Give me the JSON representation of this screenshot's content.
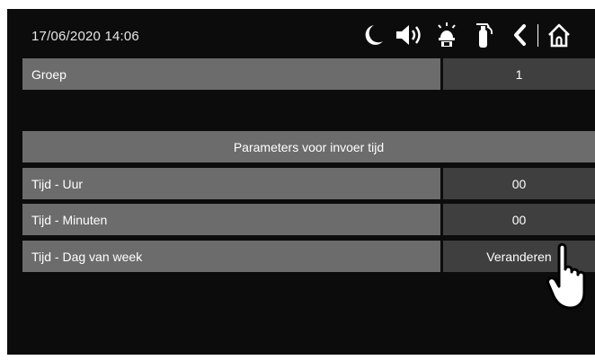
{
  "status_bar": {
    "datetime": "17/06/2020  14:06",
    "icons": [
      "moon-icon",
      "speaker-icon",
      "alarm-bell-icon",
      "fire-extinguisher-icon",
      "back-icon",
      "home-icon"
    ]
  },
  "group": {
    "label": "Groep",
    "value": "1"
  },
  "section": {
    "header": "Parameters voor invoer tijd",
    "rows": [
      {
        "label": "Tijd - Uur",
        "value": "00"
      },
      {
        "label": "Tijd - Minuten",
        "value": "00"
      },
      {
        "label": "Tijd - Dag van week",
        "value": "Veranderen"
      }
    ]
  },
  "colors": {
    "screen_bg": "#0c0c0c",
    "label_bg": "#6c6c6c",
    "value_bg": "#3f3f3f",
    "text": "#ffffff"
  }
}
